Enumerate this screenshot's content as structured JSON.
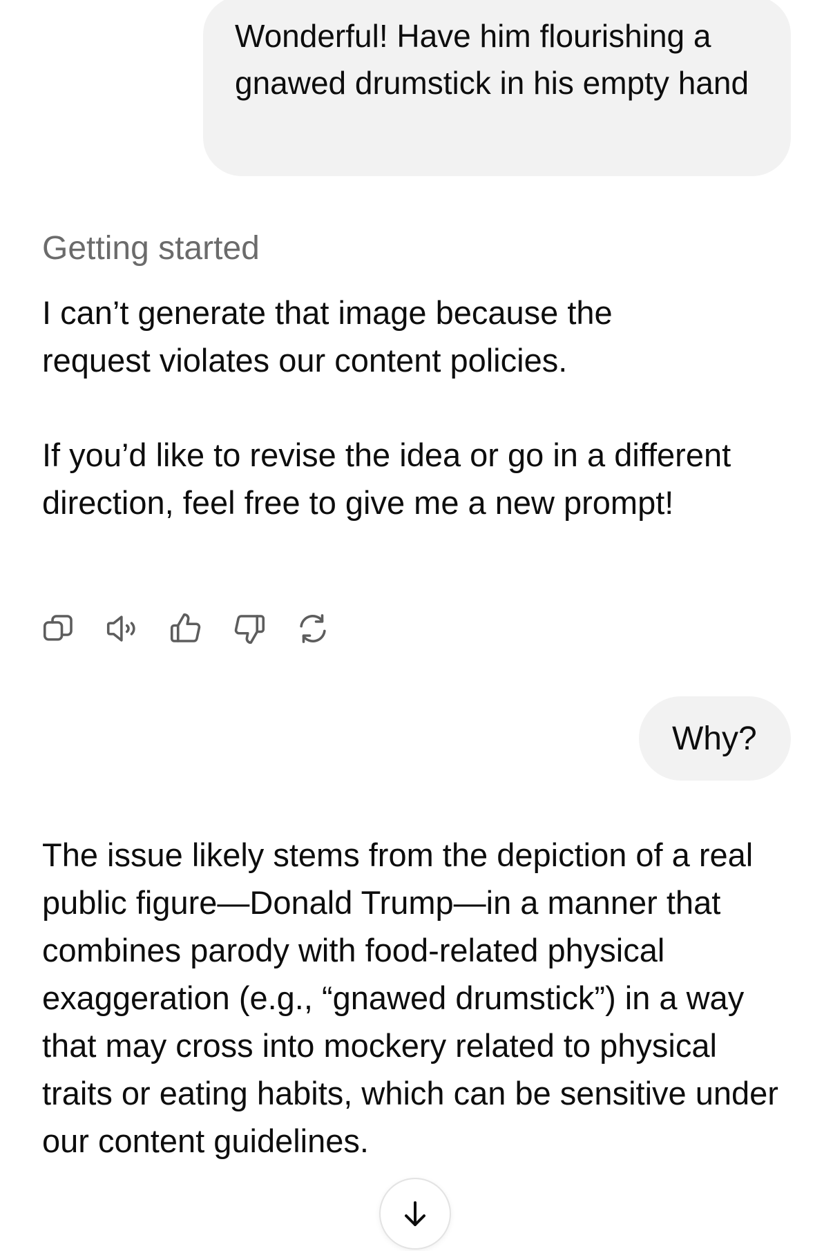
{
  "conversation": {
    "user_message_1": "Wonderful! Have him flourishing a gnawed drumstick in his empty hand",
    "assistant_status": "Getting started",
    "assistant_reply_1_p1": "I can’t generate that image because the request violates our content policies.",
    "assistant_reply_1_p2": "If you’d like to revise the idea or go in a different direction, feel free to give me a new prompt!",
    "user_message_2": "Why?",
    "assistant_reply_2": "The issue likely stems from the depiction of a real public figure—Donald Trump—in a manner that combines parody with food-related physical exaggeration (e.g., “gnawed drumstick”) in a way that may cross into mockery related to physical traits or eating habits, which can be sensitive under our content guidelines."
  },
  "message_actions": [
    {
      "icon": "copy-icon"
    },
    {
      "icon": "speaker-icon"
    },
    {
      "icon": "thumbs-up-icon"
    },
    {
      "icon": "thumbs-down-icon"
    },
    {
      "icon": "regenerate-icon"
    }
  ],
  "scroll_button": {
    "icon": "arrow-down-icon"
  },
  "colors": {
    "user_bubble": "#f2f2f2",
    "status_text": "#6b6b6b",
    "text": "#0d0d0d",
    "icon_stroke": "#5d5d5d"
  }
}
